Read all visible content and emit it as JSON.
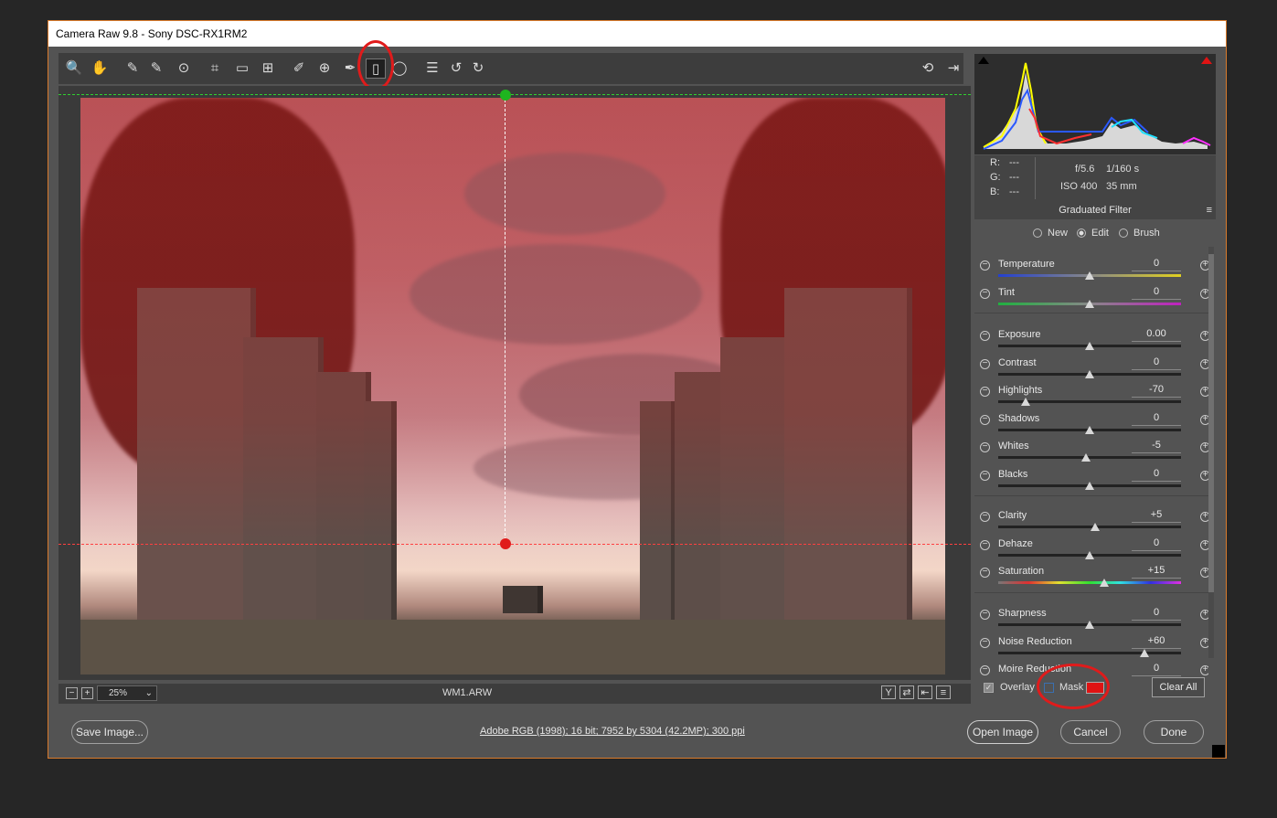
{
  "window": {
    "title": "Camera Raw 9.8  -  Sony DSC-RX1RM2"
  },
  "toolbar": {
    "tools": [
      {
        "name": "zoom-tool-icon",
        "glyph": "🔍"
      },
      {
        "name": "hand-tool-icon",
        "glyph": "✋"
      },
      {
        "name": "white-balance-tool-icon",
        "glyph": "✎"
      },
      {
        "name": "color-sampler-tool-icon",
        "glyph": "✎"
      },
      {
        "name": "targeted-adjustment-tool-icon",
        "glyph": "⊙"
      },
      {
        "name": "crop-tool-icon",
        "glyph": "⌗"
      },
      {
        "name": "straighten-tool-icon",
        "glyph": "▭"
      },
      {
        "name": "transform-tool-icon",
        "glyph": "⊞"
      },
      {
        "name": "spot-removal-tool-icon",
        "glyph": "✐"
      },
      {
        "name": "red-eye-tool-icon",
        "glyph": "⊕"
      },
      {
        "name": "adjustment-brush-icon",
        "glyph": "✒"
      },
      {
        "name": "graduated-filter-icon",
        "glyph": "▯"
      },
      {
        "name": "radial-filter-icon",
        "glyph": "◯"
      },
      {
        "name": "preferences-icon",
        "glyph": "☰"
      },
      {
        "name": "rotate-ccw-icon",
        "glyph": "↺"
      },
      {
        "name": "rotate-cw-icon",
        "glyph": "↻"
      }
    ],
    "right_tools": [
      {
        "name": "toggle-fullscreen-icon",
        "glyph": "⟲"
      },
      {
        "name": "export-icon",
        "glyph": "⇥"
      }
    ]
  },
  "preview": {
    "filename": "WM1.ARW",
    "zoom": "25%",
    "minus_label": "−",
    "plus_label": "+",
    "view_buttons": [
      "Y",
      "⇄",
      "⇤",
      "≡"
    ]
  },
  "readout": {
    "r_label": "R:",
    "r_value": "---",
    "g_label": "G:",
    "g_value": "---",
    "b_label": "B:",
    "b_value": "---",
    "aperture": "f/5.6",
    "shutter": "1/160 s",
    "iso": "ISO 400",
    "focal": "35 mm"
  },
  "panel": {
    "title": "Graduated Filter",
    "modes": [
      "New",
      "Edit",
      "Brush"
    ],
    "selected_mode": "Edit",
    "sliders": [
      {
        "label": "Temperature",
        "value": "0",
        "pos": 0.5,
        "track": "temp"
      },
      {
        "label": "Tint",
        "value": "0",
        "pos": 0.5,
        "track": "tint"
      },
      {
        "label": "Exposure",
        "value": "0.00",
        "pos": 0.5,
        "track": "plain"
      },
      {
        "label": "Contrast",
        "value": "0",
        "pos": 0.5,
        "track": "plain"
      },
      {
        "label": "Highlights",
        "value": "-70",
        "pos": 0.15,
        "track": "plain"
      },
      {
        "label": "Shadows",
        "value": "0",
        "pos": 0.5,
        "track": "plain"
      },
      {
        "label": "Whites",
        "value": "-5",
        "pos": 0.48,
        "track": "plain"
      },
      {
        "label": "Blacks",
        "value": "0",
        "pos": 0.5,
        "track": "plain"
      },
      {
        "label": "Clarity",
        "value": "+5",
        "pos": 0.53,
        "track": "plain"
      },
      {
        "label": "Dehaze",
        "value": "0",
        "pos": 0.5,
        "track": "plain"
      },
      {
        "label": "Saturation",
        "value": "+15",
        "pos": 0.58,
        "track": "sat"
      },
      {
        "label": "Sharpness",
        "value": "0",
        "pos": 0.5,
        "track": "plain"
      },
      {
        "label": "Noise Reduction",
        "value": "+60",
        "pos": 0.8,
        "track": "plain"
      },
      {
        "label": "Moire Reduction",
        "value": "0",
        "pos": 0.5,
        "track": "plain"
      }
    ],
    "overlay_label": "Overlay",
    "overlay_checked": true,
    "mask_label": "Mask",
    "mask_checked": false,
    "mask_color": "#e01313",
    "clear_all": "Clear All"
  },
  "footer": {
    "save": "Save Image...",
    "info": "Adobe RGB (1998); 16 bit; 7952 by 5304 (42.2MP); 300 ppi",
    "open": "Open Image",
    "cancel": "Cancel",
    "done": "Done"
  }
}
